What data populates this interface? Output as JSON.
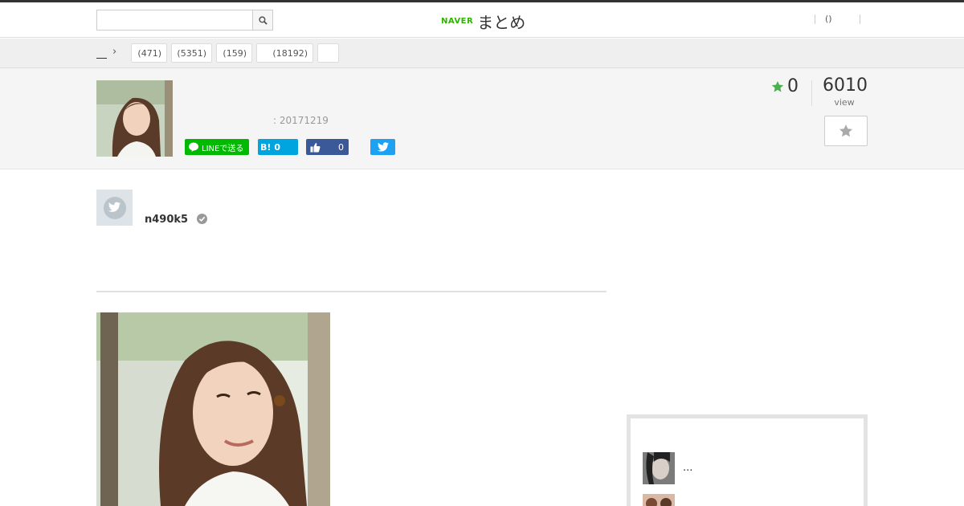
{
  "header": {
    "search_placeholder": "",
    "logo_naver": "NAVER",
    "logo_matome": "まとめ",
    "right_links": [
      "()"
    ]
  },
  "breadcrumb": {
    "categories": [
      {
        "label": "(471)"
      },
      {
        "label": "(5351)"
      },
      {
        "label": "(159)"
      },
      {
        "label": "(18192)"
      },
      {
        "label": ""
      }
    ]
  },
  "article": {
    "date": ": 20171219",
    "share": {
      "line_label": "LINEで送る",
      "hatena_label": "B!",
      "hatena_count": "0",
      "facebook_count": "0"
    },
    "favorites": "0",
    "views": "6010",
    "views_label": "view"
  },
  "author": {
    "name": "n490k5"
  },
  "sidebar": {
    "items": [
      {
        "text": "..."
      },
      {
        "text": ""
      }
    ]
  },
  "colors": {
    "naver_green": "#2db400",
    "line_green": "#00b900",
    "hatena_blue": "#00a4de",
    "facebook_blue": "#3b5998",
    "twitter_blue": "#1da1f2",
    "star_green": "#4caf50"
  },
  "icons": [
    "search-icon",
    "chevron-right-icon",
    "star-icon",
    "twitter-icon",
    "like-icon",
    "line-icon",
    "verified-icon"
  ]
}
